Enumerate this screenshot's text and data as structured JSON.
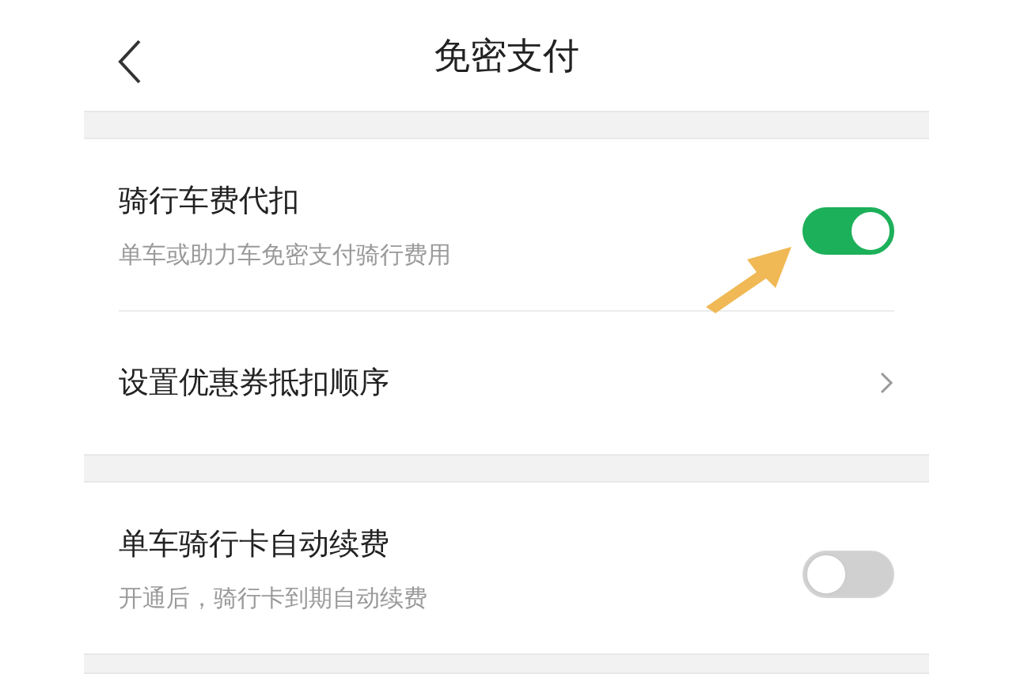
{
  "header": {
    "title": "免密支付"
  },
  "sections": [
    {
      "rows": [
        {
          "kind": "toggle",
          "title": "骑行车费代扣",
          "subtitle": "单车或助力车免密支付骑行费用",
          "on": true
        },
        {
          "kind": "link",
          "title": "设置优惠券抵扣顺序"
        }
      ]
    },
    {
      "rows": [
        {
          "kind": "toggle",
          "title": "单车骑行卡自动续费",
          "subtitle": "开通后，骑行卡到期自动续费",
          "on": false
        }
      ]
    }
  ]
}
